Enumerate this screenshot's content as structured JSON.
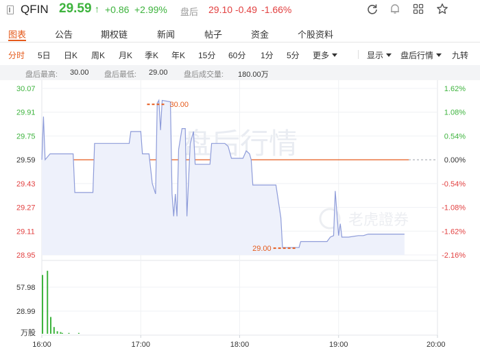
{
  "header": {
    "symbol": "QFIN",
    "price": "29.59",
    "arrow": "↑",
    "change": "+0.86",
    "change_pct": "+2.99%",
    "after_hours_label": "盘后",
    "after_hours_price": "29.10",
    "after_hours_change": "-0.49",
    "after_hours_change_pct": "-1.66%",
    "icons": [
      "refresh-icon",
      "bell-icon",
      "grid-icon",
      "star-icon"
    ],
    "colors": {
      "up": "#3db33d",
      "down": "#e24040",
      "accent": "#e55a1b"
    }
  },
  "tabs": [
    "图表",
    "公告",
    "期权链",
    "新闻",
    "帖子",
    "资金",
    "个股资料"
  ],
  "active_tab": 0,
  "periods": [
    "分时",
    "5日",
    "日K",
    "周K",
    "月K",
    "季K",
    "年K",
    "15分",
    "60分",
    "1分",
    "5分",
    "更多"
  ],
  "active_period": 0,
  "right_controls": {
    "display": "显示",
    "after_hours_quote": "盘后行情",
    "nine_turn": "九转"
  },
  "info_bar": {
    "high_label": "盘后最高:",
    "high": "30.00",
    "low_label": "盘后最低:",
    "low": "29.00",
    "volume_label": "盘后成交量:",
    "volume": "180.00万"
  },
  "chart_data": {
    "type": "line",
    "watermark": "盘后行情",
    "brand_watermark": "老虎證券",
    "price_ticks": [
      "30.07",
      "29.91",
      "29.75",
      "29.59",
      "29.43",
      "29.27",
      "29.11",
      "28.95"
    ],
    "pct_ticks": [
      "1.62%",
      "1.08%",
      "0.54%",
      "0.00%",
      "-0.54%",
      "-1.08%",
      "-1.62%",
      "-2.16%"
    ],
    "ylim": [
      28.95,
      30.07
    ],
    "reference_price": 29.59,
    "time_ticks": [
      "16:00",
      "17:00",
      "18:00",
      "19:00",
      "20:00"
    ],
    "xlim_minutes": [
      0,
      240
    ],
    "max_marker": {
      "label": "30.00",
      "t": 63,
      "price": 30.0
    },
    "min_marker": {
      "label": "29.00",
      "t": 155,
      "price": 29.0
    },
    "price_series": [
      [
        0,
        29.59
      ],
      [
        1,
        29.88
      ],
      [
        2,
        29.59
      ],
      [
        5,
        29.63
      ],
      [
        19,
        29.63
      ],
      [
        20,
        29.37
      ],
      [
        31,
        29.37
      ],
      [
        32,
        29.7
      ],
      [
        53,
        29.7
      ],
      [
        54,
        29.78
      ],
      [
        60,
        29.78
      ],
      [
        61,
        29.63
      ],
      [
        65,
        29.63
      ],
      [
        67,
        29.43
      ],
      [
        69,
        29.36
      ],
      [
        70,
        29.97
      ],
      [
        71,
        29.99
      ],
      [
        72,
        29.79
      ],
      [
        73,
        29.99
      ],
      [
        78,
        29.98
      ],
      [
        79,
        29.36
      ],
      [
        80,
        29.21
      ],
      [
        81,
        29.36
      ],
      [
        82,
        29.21
      ],
      [
        83,
        29.66
      ],
      [
        85,
        29.8
      ],
      [
        87,
        29.8
      ],
      [
        88,
        29.21
      ],
      [
        90,
        29.7
      ],
      [
        92,
        29.78
      ],
      [
        93,
        29.56
      ],
      [
        102,
        29.56
      ],
      [
        103,
        29.7
      ],
      [
        111,
        29.7
      ],
      [
        113,
        29.68
      ],
      [
        115,
        29.6
      ],
      [
        122,
        29.6
      ],
      [
        124,
        29.65
      ],
      [
        126,
        29.63
      ],
      [
        127,
        29.59
      ],
      [
        128,
        29.42
      ],
      [
        142,
        29.42
      ],
      [
        145,
        29.2
      ],
      [
        146,
        29.0
      ],
      [
        156,
        29.0
      ],
      [
        157,
        29.04
      ],
      [
        173,
        29.04
      ],
      [
        175,
        29.07
      ],
      [
        177,
        29.08
      ],
      [
        178,
        29.38
      ],
      [
        180,
        29.08
      ],
      [
        181,
        29.16
      ],
      [
        182,
        29.07
      ],
      [
        186,
        29.07
      ],
      [
        192,
        29.08
      ],
      [
        195,
        29.08
      ],
      [
        198,
        29.09
      ],
      [
        220,
        29.09
      ]
    ],
    "volume_ticks": [
      "57.98",
      "28.99"
    ],
    "volume_unit": "万股",
    "volume_ymax": 80,
    "volume_series": [
      [
        0,
        70
      ],
      [
        3,
        75
      ],
      [
        5,
        20
      ],
      [
        7,
        8
      ],
      [
        9,
        3
      ],
      [
        11,
        2
      ],
      [
        12,
        1
      ],
      [
        16,
        1
      ],
      [
        22,
        1
      ]
    ]
  }
}
